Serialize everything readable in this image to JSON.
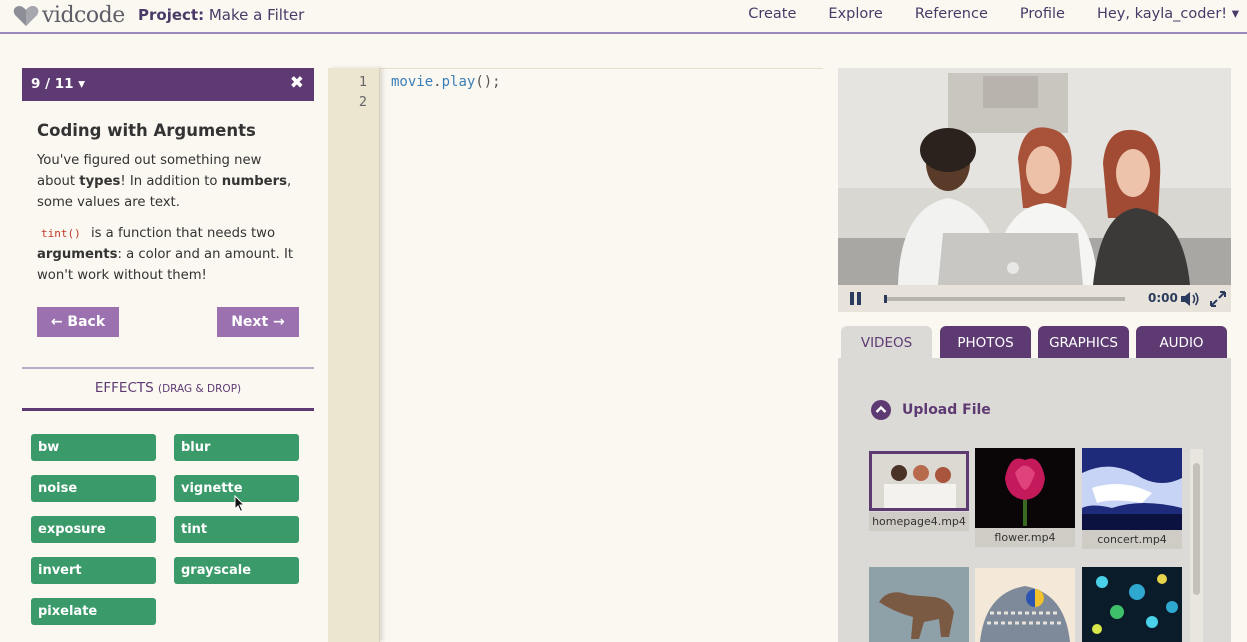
{
  "header": {
    "logo_text": "vidcode",
    "project_prefix": "Project:",
    "project_name": "Make a Filter",
    "nav": [
      "Create",
      "Explore",
      "Reference",
      "Profile",
      "Hey, kayla_coder! ▾"
    ]
  },
  "lesson": {
    "step": "9 / 11",
    "title": "Coding with Arguments",
    "p1_a": "You've figured out something new about",
    "p1_types": "types",
    "p1_b": "! In addition to",
    "p1_numbers": "numbers",
    "p1_c": ", some values are text.",
    "p2_code": "tint()",
    "p2_a": "is a function that needs two",
    "p2_arguments": "arguments",
    "p2_b": ": a color and an amount. It won't work without them!",
    "back_label": "← Back",
    "next_label": "Next →"
  },
  "effects": {
    "title": "EFFECTS",
    "subtitle": "(DRAG & DROP)",
    "items": [
      "bw",
      "blur",
      "noise",
      "vignette",
      "exposure",
      "tint",
      "invert",
      "grayscale",
      "pixelate"
    ]
  },
  "editor": {
    "line_numbers": [
      "1",
      "2"
    ],
    "code_object": "movie",
    "code_dot": ".",
    "code_method": "play",
    "code_end": "();"
  },
  "player": {
    "time": "0:00",
    "progress": 0
  },
  "media": {
    "tabs": [
      "VIDEOS",
      "PHOTOS",
      "GRAPHICS",
      "AUDIO"
    ],
    "active_tab": "VIDEOS",
    "upload_label": "Upload File",
    "files": [
      "homepage4.mp4",
      "flower.mp4",
      "concert.mp4"
    ]
  },
  "colors": {
    "brand_purple": "#5e3a73",
    "button_purple": "#9b71b0",
    "effect_green": "#3a9a6a",
    "code_blue": "#3b7fb8"
  }
}
